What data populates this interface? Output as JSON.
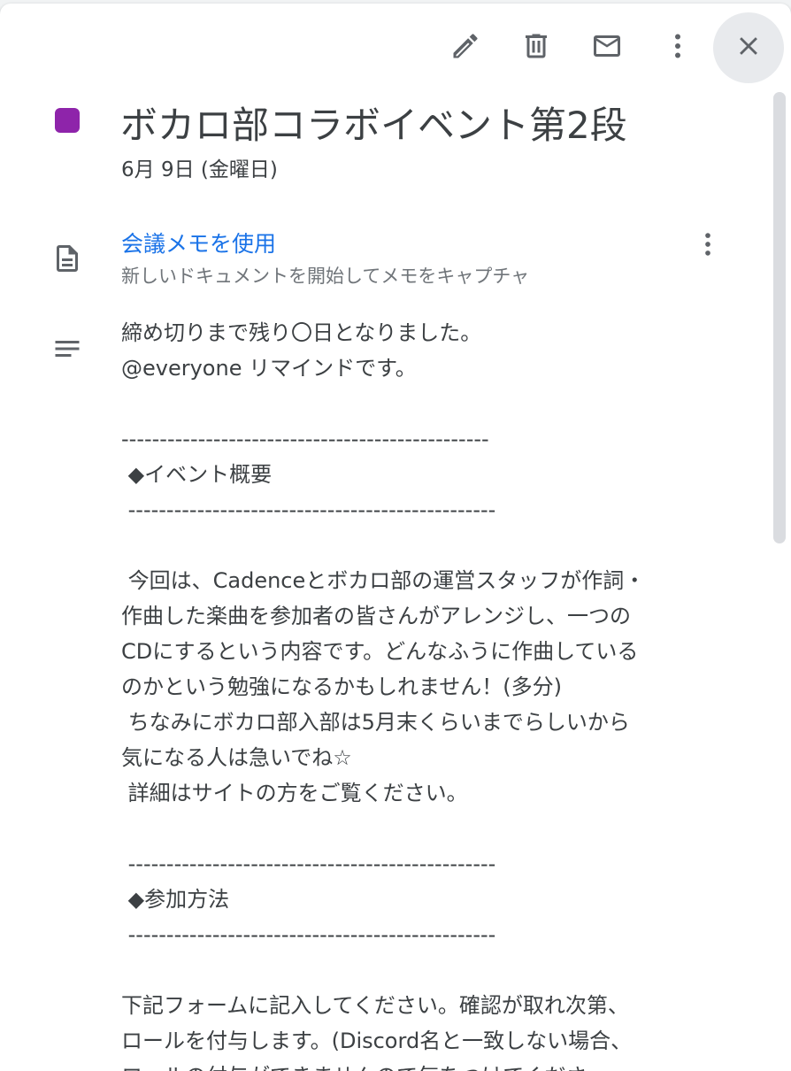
{
  "toolbar": {
    "edit_icon": "pencil-icon",
    "delete_icon": "trash-icon",
    "email_icon": "mail-icon",
    "more_icon": "vertical-dots-icon",
    "close_icon": "close-icon"
  },
  "event": {
    "color": "#8e24aa",
    "title": "ボカロ部コラボイベント第2段",
    "date": "6月 9日 (金曜日)"
  },
  "meeting_notes": {
    "icon": "document-icon",
    "title": "会議メモを使用",
    "subtitle": "新しいドキュメントを開始してメモをキャプチャ",
    "more_icon": "vertical-dots-icon"
  },
  "description": {
    "icon": "notes-lines-icon",
    "lines": [
      "締め切りまで残り〇日となりました。",
      "@everyone リマインドです。",
      "",
      "------------------------------------------------",
      " ◆イベント概要",
      " ------------------------------------------------",
      "",
      " 今回は、Cadenceとボカロ部の運営スタッフが作詞・",
      "作曲した楽曲を参加者の皆さんがアレンジし、一つの",
      "CDにするという内容です。どんなふうに作曲している",
      "のかという勉強になるかもしれません！(多分)",
      " ちなみにボカロ部入部は5月末くらいまでらしいから",
      "気になる人は急いでね☆",
      " 詳細はサイトの方をご覧ください。",
      "",
      " ------------------------------------------------",
      " ◆参加方法",
      " ------------------------------------------------",
      "",
      "下記フォームに記入してください。確認が取れ次第、",
      "ロールを付与します。(Discord名と一致しない場合、",
      "ロールの付与ができませんので気をつけてくださ"
    ]
  }
}
